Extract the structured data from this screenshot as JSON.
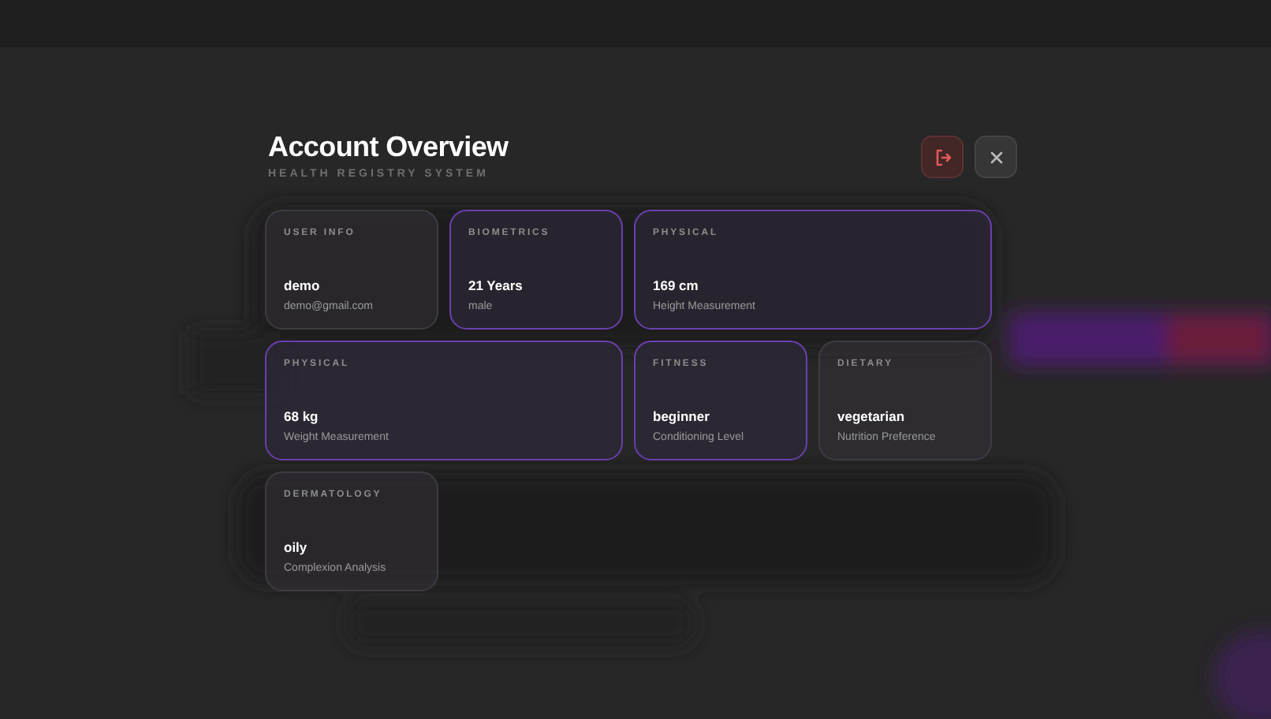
{
  "title": "Account Overview",
  "subtitle": "HEALTH REGISTRY SYSTEM",
  "actions": [
    {
      "kind": "logout"
    },
    {
      "kind": "close"
    }
  ],
  "cards": [
    {
      "label": "USER INFO",
      "value": "demo",
      "detail": "demo@gmail.com",
      "highlighted": false
    },
    {
      "label": "BIOMETRICS",
      "value": "21 Years",
      "detail": "male",
      "highlighted": true
    },
    {
      "label": "PHYSICAL",
      "value": "169 cm",
      "detail": "Height Measurement",
      "highlighted": true
    },
    {
      "label": "PHYSICAL",
      "value": "68 kg",
      "detail": "Weight Measurement",
      "highlighted": true
    },
    {
      "label": "FITNESS",
      "value": "beginner",
      "detail": "Conditioning Level",
      "highlighted": true
    },
    {
      "label": "DIETARY",
      "value": "vegetarian",
      "detail": "Nutrition Preference",
      "highlighted": false
    },
    {
      "label": "DERMATOLOGY",
      "value": "oily",
      "detail": "Complexion Analysis",
      "highlighted": false
    }
  ]
}
